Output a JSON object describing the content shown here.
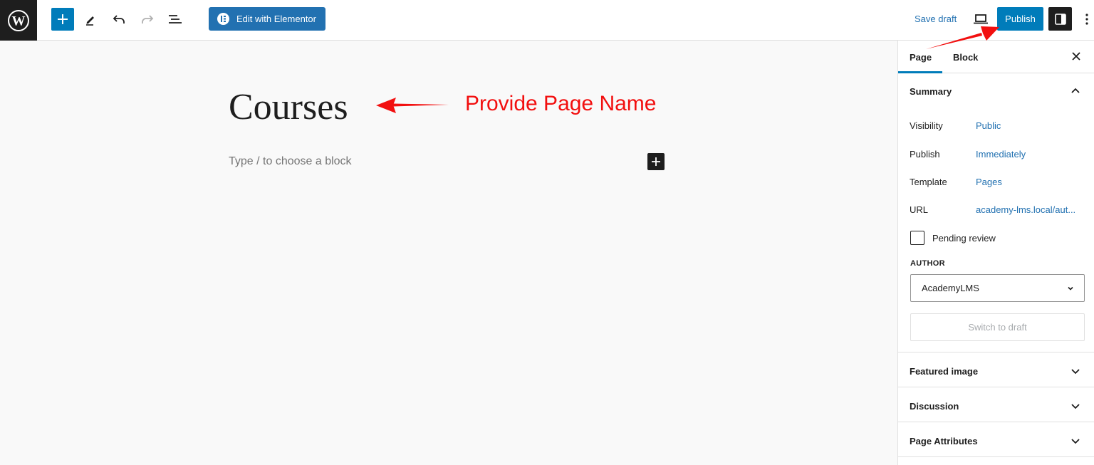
{
  "toolbar": {
    "elementor_label": "Edit with Elementor",
    "save_draft_label": "Save draft",
    "publish_label": "Publish"
  },
  "editor": {
    "title": "Courses",
    "block_placeholder": "Type / to choose a block"
  },
  "annotation": {
    "text": "Provide Page Name",
    "color": "#f20f0f"
  },
  "sidebar": {
    "tabs": [
      "Page",
      "Block"
    ],
    "summary": {
      "title": "Summary",
      "rows": [
        {
          "label": "Visibility",
          "value": "Public"
        },
        {
          "label": "Publish",
          "value": "Immediately"
        },
        {
          "label": "Template",
          "value": "Pages"
        },
        {
          "label": "URL",
          "value": "academy-lms.local/aut..."
        }
      ],
      "pending_review_label": "Pending review",
      "pending_review_checked": false,
      "author_label": "AUTHOR",
      "author_value": "AcademyLMS",
      "switch_draft_label": "Switch to draft"
    },
    "panels": [
      "Featured image",
      "Discussion",
      "Page Attributes"
    ]
  },
  "colors": {
    "accent": "#007cba",
    "link": "#2271b1",
    "elementor": "#2271b1",
    "dark": "#1e1e1e"
  }
}
